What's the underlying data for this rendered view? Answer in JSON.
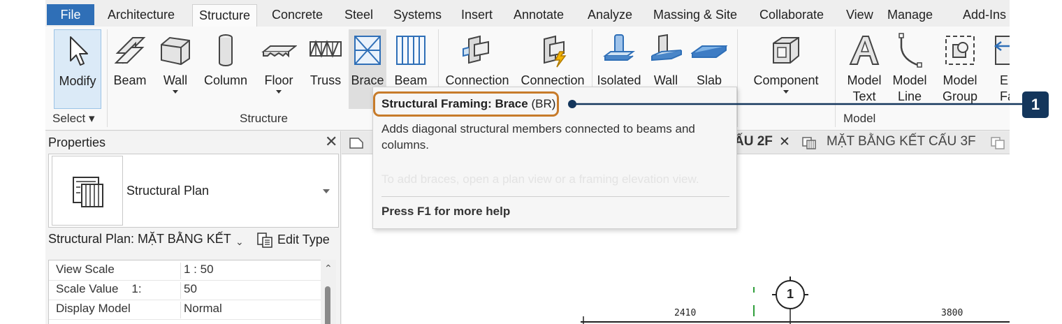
{
  "menu": {
    "file": "File",
    "tabs": [
      "Architecture",
      "Structure",
      "Concrete",
      "Steel",
      "Systems",
      "Insert",
      "Annotate",
      "Analyze",
      "Massing & Site",
      "Collaborate",
      "View",
      "Manage",
      "Add-Ins"
    ],
    "active": "Structure"
  },
  "ribbon": {
    "select": {
      "modify": "Modify",
      "label": "Select ▾"
    },
    "structure": {
      "label": "Structure",
      "tools": [
        "Beam",
        "Wall",
        "Column",
        "Floor",
        "Truss",
        "Brace",
        "Beam"
      ]
    },
    "connection": {
      "tools": [
        "Connection",
        "Connection"
      ]
    },
    "foundation": {
      "tools": [
        "Isolated",
        "Wall",
        "Slab"
      ]
    },
    "model": {
      "label": "Model",
      "component": "Component",
      "model_text_1": "Model",
      "model_text_2": "Text",
      "model_line_1": "Model",
      "model_line_2": "Line",
      "model_group_1": "Model",
      "model_group_2": "Group",
      "extra_1": "E",
      "extra_2": "Fa"
    }
  },
  "properties": {
    "title": "Properties",
    "close": "✕",
    "type_name": "Structural Plan",
    "selector": "Structural Plan: MẶT BẰNG KẾT",
    "edit_type": "Edit Type",
    "rows": [
      {
        "key": "View Scale",
        "value": "1 : 50"
      },
      {
        "key": "Scale Value    1:",
        "value": "50"
      },
      {
        "key": "Display Model",
        "value": "Normal"
      }
    ]
  },
  "view_tabs": {
    "tab1": "ẤU 2F",
    "tab1_close": "✕",
    "tab2": "MẶT BẰNG KẾT CẤU 3F"
  },
  "drawing": {
    "grid_label": "1",
    "dim1": "2410",
    "dim2": "3800"
  },
  "tooltip": {
    "title_bold": "Structural Framing: Brace",
    "title_shortcut": "(BR)",
    "description": "Adds diagonal structural members connected to beams and columns.",
    "faded_hint": "To add braces, open a plan view or a framing elevation view.",
    "help": "Press F1 for more help"
  },
  "callout": {
    "number": "1",
    "color": "#14365c",
    "highlight_color": "#c77b2a"
  }
}
